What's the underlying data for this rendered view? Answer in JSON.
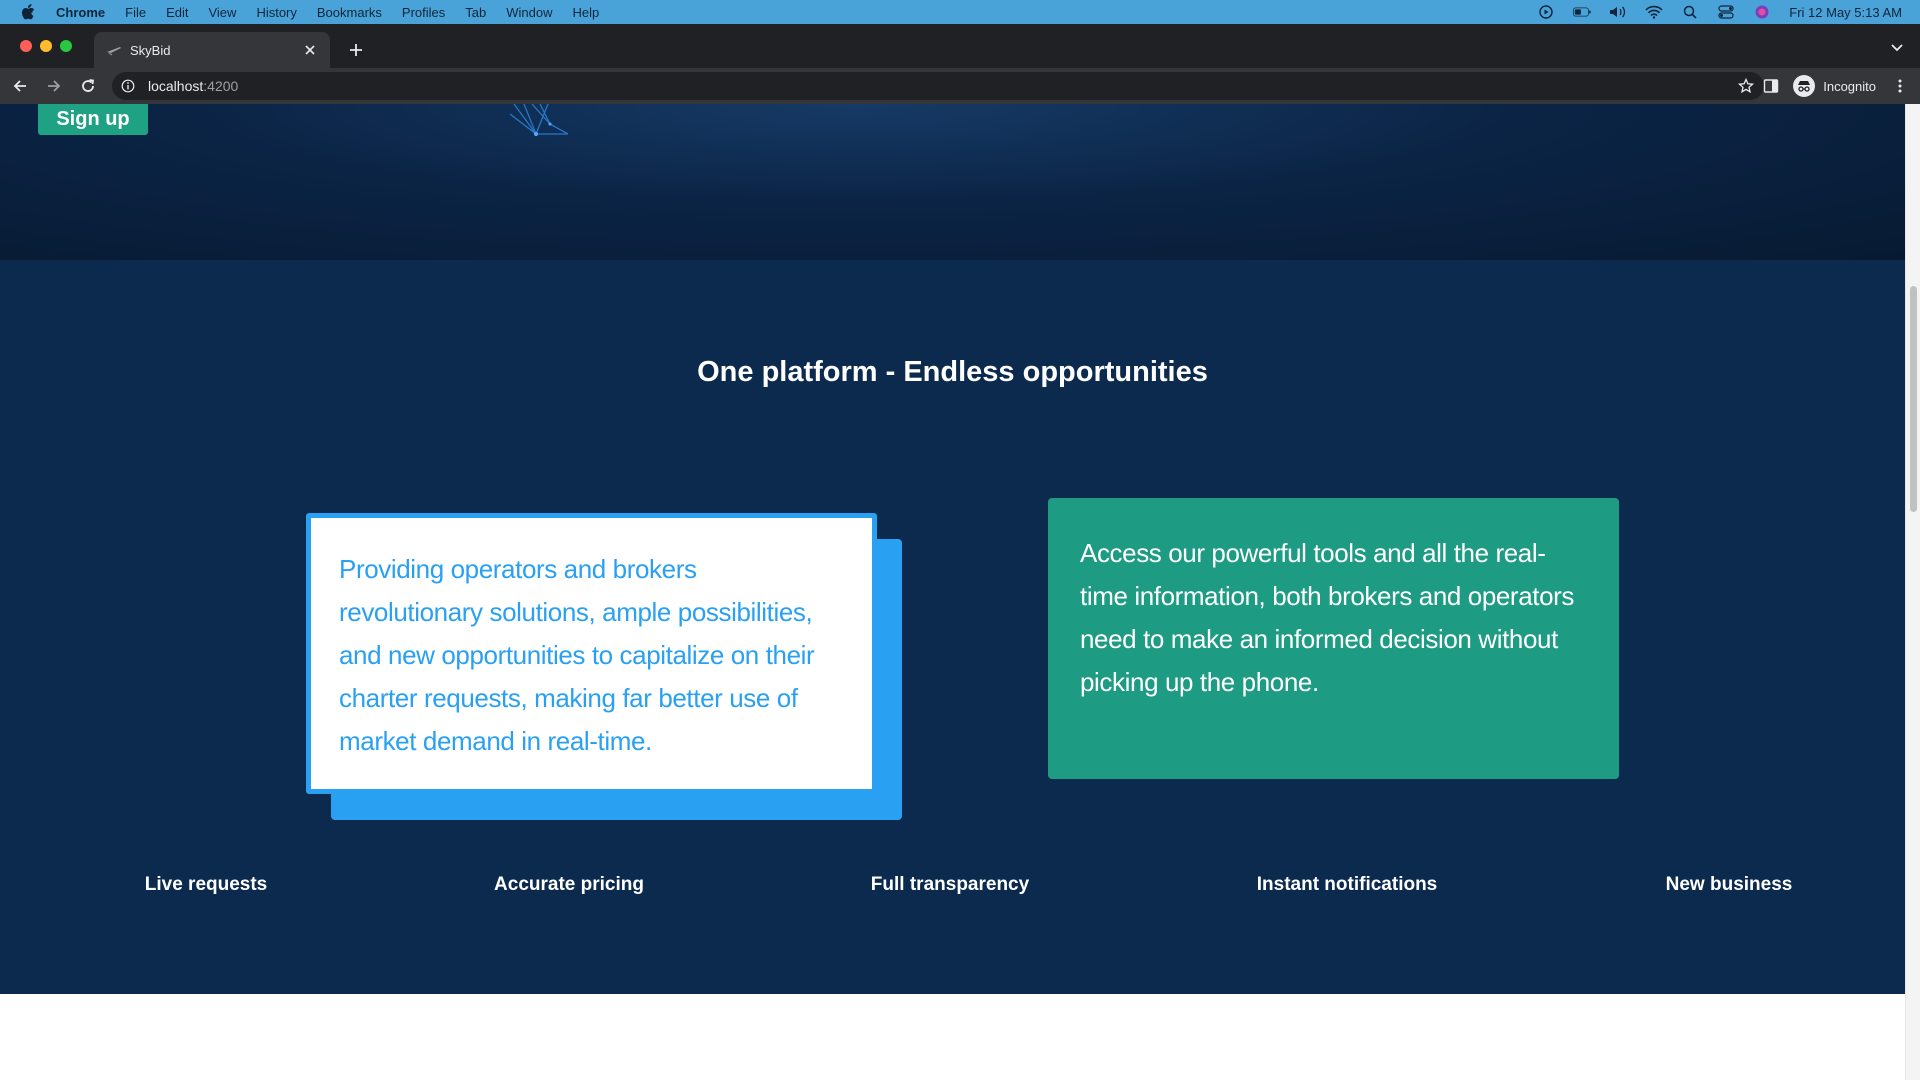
{
  "menubar": {
    "app": "Chrome",
    "items": [
      "File",
      "Edit",
      "View",
      "History",
      "Bookmarks",
      "Profiles",
      "Tab",
      "Window",
      "Help"
    ],
    "datetime": "Fri 12 May  5:13 AM"
  },
  "browser": {
    "tab_title": "SkyBid",
    "url_host": "localhost",
    "url_port": ":4200",
    "profile_label": "Incognito"
  },
  "hero": {
    "signup_label": "Sign up"
  },
  "section": {
    "heading": "One platform - Endless opportunities",
    "card_left_text": "Providing operators and brokers revolutionary solutions, ample possibilities, and new opportunities to capitalize on their charter requests, making far better use of market demand in real-time.",
    "card_right_text": "Access our powerful tools and all the real-time information, both brokers and operators need to make an informed decision without picking up the phone.",
    "features": [
      "Live requests",
      "Accurate pricing",
      "Full transparency",
      "Instant notifications",
      "New business"
    ]
  },
  "colors": {
    "navy": "#0b2a4e",
    "blue": "#2aa0f3",
    "green": "#1d9b83",
    "signup_green": "#1fa284"
  }
}
